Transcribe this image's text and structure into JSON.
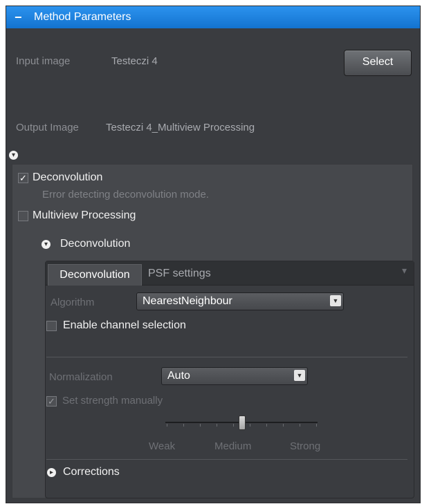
{
  "header": {
    "title": "Method Parameters"
  },
  "input": {
    "label": "Input image",
    "value": "Testeczi 4",
    "select_label": "Select"
  },
  "output": {
    "label": "Output Image",
    "value": "Testeczi 4_Multiview Processing"
  },
  "options": {
    "deconvolution": {
      "label": "Deconvolution",
      "checked": true,
      "error": "Error detecting deconvolution mode."
    },
    "multiview": {
      "label": "Multiview Processing",
      "checked": false
    }
  },
  "section": {
    "title": "Deconvolution"
  },
  "tabs": {
    "active": "Deconvolution",
    "inactive": "PSF settings"
  },
  "algorithm": {
    "label": "Algorithm",
    "value": "NearestNeighbour"
  },
  "channel_selection": {
    "label": "Enable channel selection",
    "checked": false
  },
  "normalization": {
    "label": "Normalization",
    "value": "Auto"
  },
  "strength": {
    "label": "Set strength manually",
    "checked": true,
    "slider_fraction": 0.5,
    "labels": [
      "Weak",
      "Medium",
      "Strong"
    ]
  },
  "corrections": {
    "label": "Corrections"
  },
  "colors": {
    "accent": "#1c83e2",
    "panel": "#3a3c40",
    "inner": "#46484c"
  }
}
